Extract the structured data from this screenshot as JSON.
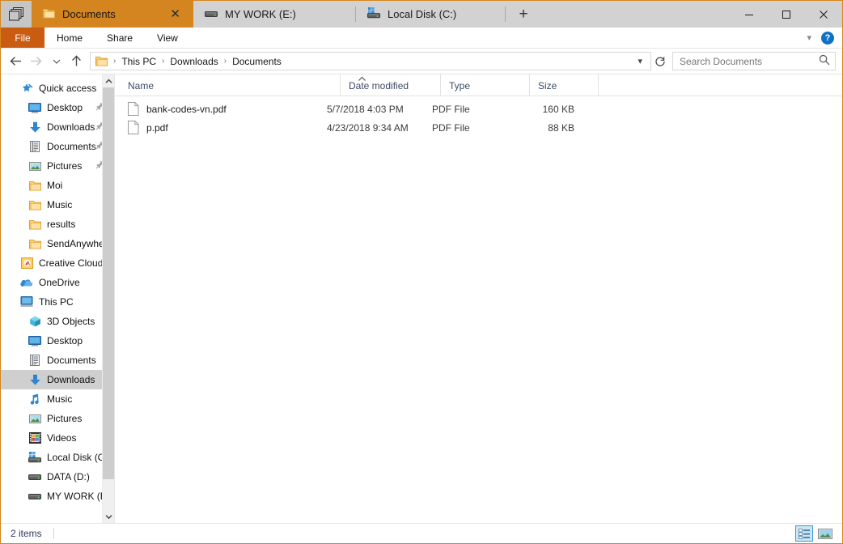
{
  "window": {
    "app_icon": "tabs-stack-icon",
    "minimize_label": "─",
    "maximize_label": "□",
    "close_label": "✕"
  },
  "tabs": {
    "new_tab_label": "+",
    "items": [
      {
        "label": "Documents",
        "icon": "folder-icon",
        "active": true,
        "close_label": "✕"
      },
      {
        "label": "MY WORK (E:)",
        "icon": "harddrive-icon",
        "active": false,
        "close_label": ""
      },
      {
        "label": "Local Disk (C:)",
        "icon": "windows-drive-icon",
        "active": false,
        "close_label": ""
      }
    ]
  },
  "ribbon": {
    "file_label": "File",
    "items": [
      "Home",
      "Share",
      "View"
    ],
    "expand_icon": "chevron-down-icon",
    "help_label": "?"
  },
  "address": {
    "back_icon": "arrow-left-icon",
    "forward_icon": "arrow-right-icon",
    "recent_icon": "chevron-down-icon",
    "up_icon": "arrow-up-icon",
    "folder_icon": "folder-icon",
    "crumbs": [
      "This PC",
      "Downloads",
      "Documents"
    ],
    "separator": "›",
    "dropdown_icon": "chevron-down-icon",
    "refresh_icon": "refresh-icon"
  },
  "search": {
    "placeholder": "Search Documents",
    "value": "",
    "icon": "search-icon"
  },
  "sidebar": {
    "scroll_up_icon": "chevron-up-icon",
    "scroll_down_icon": "chevron-down-icon",
    "items": [
      {
        "label": "Quick access",
        "icon": "star-pin-icon",
        "level": 0,
        "pinned": false,
        "selected": false
      },
      {
        "label": "Desktop",
        "icon": "desktop-icon",
        "level": 1,
        "pinned": true,
        "selected": false
      },
      {
        "label": "Downloads",
        "icon": "download-icon",
        "level": 1,
        "pinned": true,
        "selected": false
      },
      {
        "label": "Documents",
        "icon": "documents-icon",
        "level": 1,
        "pinned": true,
        "selected": false
      },
      {
        "label": "Pictures",
        "icon": "pictures-icon",
        "level": 1,
        "pinned": true,
        "selected": false
      },
      {
        "label": "Moi",
        "icon": "folder-icon",
        "level": 1,
        "pinned": false,
        "selected": false
      },
      {
        "label": "Music",
        "icon": "folder-icon",
        "level": 1,
        "pinned": false,
        "selected": false
      },
      {
        "label": "results",
        "icon": "folder-icon",
        "level": 1,
        "pinned": false,
        "selected": false
      },
      {
        "label": "SendAnywhere",
        "icon": "folder-icon",
        "level": 1,
        "pinned": false,
        "selected": false
      },
      {
        "label": "Creative Cloud Fil",
        "icon": "creativecloud-icon",
        "level": 0,
        "pinned": false,
        "selected": false
      },
      {
        "label": "OneDrive",
        "icon": "onedrive-icon",
        "level": 0,
        "pinned": false,
        "selected": false
      },
      {
        "label": "This PC",
        "icon": "thispc-icon",
        "level": 0,
        "pinned": false,
        "selected": false
      },
      {
        "label": "3D Objects",
        "icon": "3dobjects-icon",
        "level": 1,
        "pinned": false,
        "selected": false
      },
      {
        "label": "Desktop",
        "icon": "desktop-icon",
        "level": 1,
        "pinned": false,
        "selected": false
      },
      {
        "label": "Documents",
        "icon": "documents-icon",
        "level": 1,
        "pinned": false,
        "selected": false
      },
      {
        "label": "Downloads",
        "icon": "download-icon",
        "level": 1,
        "pinned": false,
        "selected": true
      },
      {
        "label": "Music",
        "icon": "music-icon",
        "level": 1,
        "pinned": false,
        "selected": false
      },
      {
        "label": "Pictures",
        "icon": "pictures-icon",
        "level": 1,
        "pinned": false,
        "selected": false
      },
      {
        "label": "Videos",
        "icon": "videos-icon",
        "level": 1,
        "pinned": false,
        "selected": false
      },
      {
        "label": "Local Disk (C:)",
        "icon": "windows-drive-icon",
        "level": 1,
        "pinned": false,
        "selected": false
      },
      {
        "label": "DATA (D:)",
        "icon": "harddrive-icon",
        "level": 1,
        "pinned": false,
        "selected": false
      },
      {
        "label": "MY WORK (E:)",
        "icon": "harddrive-icon",
        "level": 1,
        "pinned": false,
        "selected": false
      }
    ]
  },
  "filelist": {
    "columns": [
      {
        "label": "Name",
        "sorted": true,
        "sort_icon": "chevron-up-icon"
      },
      {
        "label": "Date modified",
        "sorted": false,
        "sort_icon": ""
      },
      {
        "label": "Type",
        "sorted": false,
        "sort_icon": ""
      },
      {
        "label": "Size",
        "sorted": false,
        "sort_icon": ""
      }
    ],
    "rows": [
      {
        "name": "bank-codes-vn.pdf",
        "date": "5/7/2018 4:03 PM",
        "type": "PDF File",
        "size": "160 KB",
        "icon": "file-icon"
      },
      {
        "name": "p.pdf",
        "date": "4/23/2018 9:34 AM",
        "type": "PDF File",
        "size": "88 KB",
        "icon": "file-icon"
      }
    ]
  },
  "statusbar": {
    "count": "2 items",
    "views": [
      {
        "name": "details-view",
        "active": true
      },
      {
        "name": "large-icons-view",
        "active": false
      }
    ]
  },
  "colors": {
    "active_tab": "#d4851f",
    "file_menu": "#ca5c11",
    "window_border": "#d4851f",
    "selection": "#cfcfcf",
    "header_text": "#3d4a66",
    "help_blue": "#1171c5",
    "view_active": "#cde6f2"
  }
}
